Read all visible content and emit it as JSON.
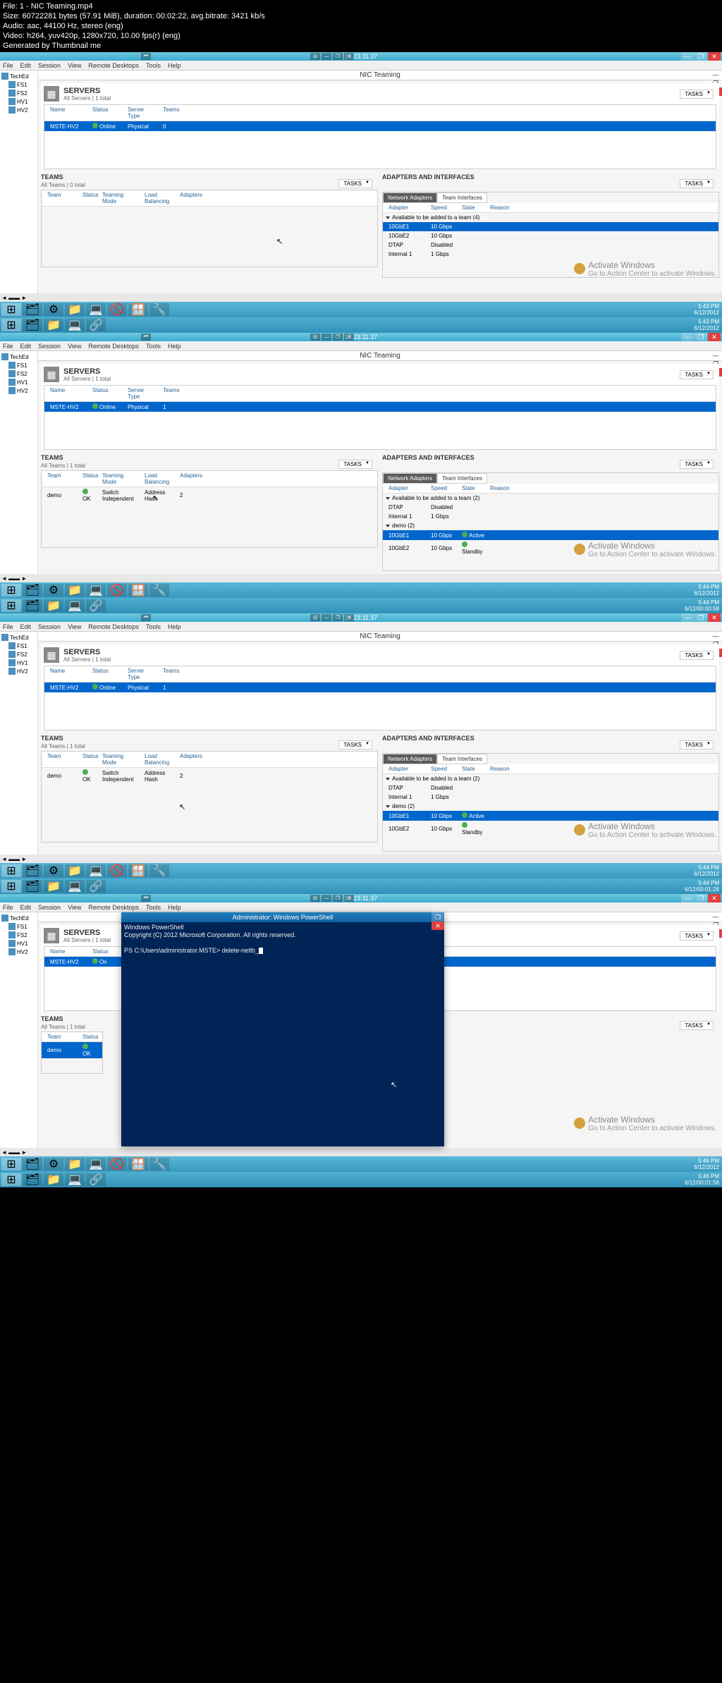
{
  "video": {
    "file": "File: 1 - NIC Teaming.mp4",
    "size": "Size: 60722281 bytes (57.91 MiB), duration: 00:02:22, avg.bitrate: 3421 kb/s",
    "audio": "Audio: aac, 44100 Hz, stereo (eng)",
    "vcodec": "Video: h264, yuv420p, 1280x720, 10.00 fps(r) (eng)",
    "gen": "Generated by Thumbnail me"
  },
  "remote_ip": "10.23.11.37",
  "menu": {
    "file": "File",
    "edit": "Edit",
    "session": "Session",
    "view": "View",
    "remote": "Remote Desktops",
    "tools": "Tools",
    "help": "Help"
  },
  "tree": {
    "root": "TechEd",
    "n1": "FS1",
    "n2": "FS2",
    "n3": "HV1",
    "n4": "HV2"
  },
  "win_title": "NIC Teaming",
  "tasks": "TASKS",
  "servers": {
    "title": "SERVERS",
    "sub": "All Servers | 1 total",
    "cols": {
      "name": "Name",
      "status": "Status",
      "type": "Server Type",
      "teams": "Teams"
    },
    "row": {
      "name": "MSTE-HV2",
      "status": "Online",
      "type": "Physical",
      "teams0": "0",
      "teams1": "1"
    }
  },
  "teams": {
    "title": "TEAMS",
    "sub0": "All Teams | 0 total",
    "sub1": "All Teams | 1 total",
    "cols": {
      "team": "Team",
      "status": "Status",
      "mode": "Teaming Mode",
      "lb": "Load Balancing",
      "ad": "Adapters"
    },
    "row": {
      "team": "demo",
      "status": "OK",
      "mode": "Switch Independent",
      "lb": "Address Hash",
      "ad": "2"
    }
  },
  "adapters": {
    "title": "ADAPTERS AND INTERFACES",
    "tab1": "Network Adapters",
    "tab2": "Team Interfaces",
    "cols": {
      "adapter": "Adapter",
      "speed": "Speed",
      "state": "State",
      "reason": "Reason"
    },
    "avail4": "Available to be added to a team (4)",
    "avail2": "Available to be added to a team (2)",
    "demo2": "demo (2)",
    "rows": {
      "gbe1": {
        "name": "10GbE1",
        "speed": "10 Gbps",
        "state_active": "Active",
        "state_standby": "Standby"
      },
      "gbe2": {
        "name": "10GbE2",
        "speed": "10 Gbps"
      },
      "dtap": {
        "name": "DTAP",
        "speed": "Disabled"
      },
      "int1": {
        "name": "Internal 1",
        "speed": "1 Gbps"
      }
    }
  },
  "watermark": {
    "title": "Activate Windows",
    "sub": "Go to Action Center to activate Windows."
  },
  "times": {
    "t1": "5:43 PM",
    "t2": "5:44 PM",
    "t3": "5:46 PM",
    "date": "6/12/2012"
  },
  "frame_ids": {
    "f1": "",
    "f2": "6/12/00:00:58",
    "f3": "6/12/00:01:26",
    "f4": "6/12/00:01:58"
  },
  "ps": {
    "title": "Administrator: Windows PowerShell",
    "l1": "Windows PowerShell",
    "l2": "Copyright (C) 2012 Microsoft Corporation. All rights reserved.",
    "prompt": "PS C:\\Users\\administrator.MSTE> delete-netlb_"
  }
}
